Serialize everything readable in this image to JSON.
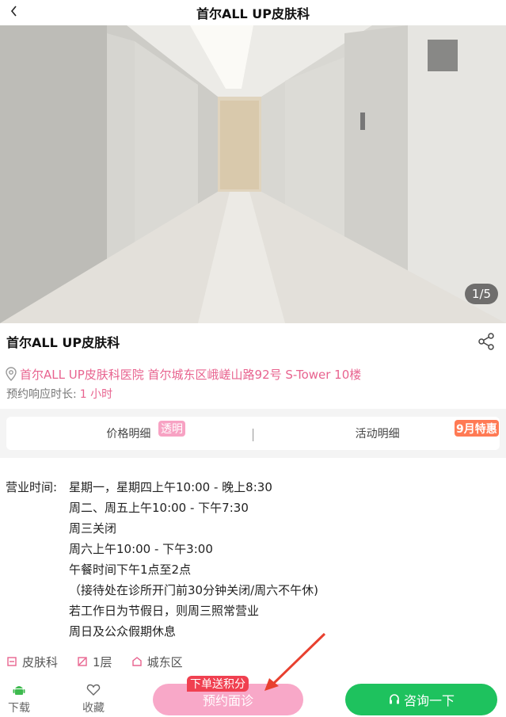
{
  "header": {
    "title": "首尔ALL UP皮肤科"
  },
  "gallery": {
    "counter": "1/5"
  },
  "clinic": {
    "name": "首尔ALL UP皮肤科",
    "address": "首尔ALL UP皮肤科医院 首尔城东区峨嵯山路92号 S-Tower 10楼",
    "response_label": "预约响应时长:",
    "response_value": "1 小时"
  },
  "tabs": {
    "price": "价格明细",
    "price_badge": "透明",
    "separator": "|",
    "activity": "活动明细",
    "activity_badge": "9月特惠"
  },
  "hours": {
    "label": "营业时间:",
    "lines": [
      "星期一，星期四上午10:00 - 晚上8:30",
      "周二、周五上午10:00 - 下午7:30",
      "周三关闭",
      "周六上午10:00 - 下午3:00",
      "午餐时间下午1点至2点",
      "（接待处在诊所开门前30分钟关闭/周六不午休)",
      "若工作日为节假日，则周三照常营业",
      "周日及公众假期休息"
    ]
  },
  "tags": {
    "category": "皮肤科",
    "floor": "1层",
    "district": "城东区"
  },
  "bottom_bar": {
    "download": "下载",
    "favorite": "收藏",
    "book": "预约面诊",
    "promo": "下单送积分",
    "consult": "咨询一下"
  },
  "colors": {
    "accent_pink": "#e8638f",
    "book_button": "#f8a8c8",
    "consult_button": "#1ec25e",
    "promo_red": "#f04050"
  }
}
